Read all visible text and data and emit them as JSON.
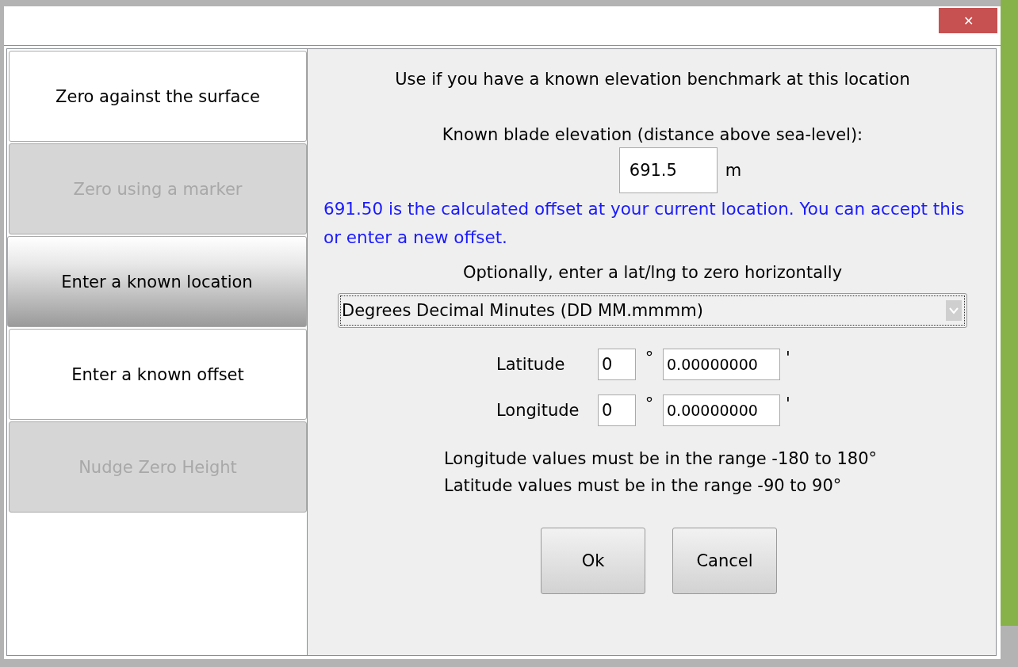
{
  "window": {
    "close": "✕"
  },
  "sidebar": {
    "items": [
      {
        "label": "Zero against the surface",
        "selected": false,
        "disabled": false
      },
      {
        "label": "Zero using a marker",
        "selected": false,
        "disabled": true
      },
      {
        "label": "Enter a known location",
        "selected": true,
        "disabled": false
      },
      {
        "label": "Enter a known offset",
        "selected": false,
        "disabled": false
      },
      {
        "label": "Nudge Zero Height",
        "selected": false,
        "disabled": true
      }
    ]
  },
  "panel": {
    "intro": "Use if you have a known elevation benchmark at this location",
    "elevation_label": "Known blade elevation (distance above sea-level):",
    "elevation_value": "691.5",
    "elevation_unit": "m",
    "notice": "691.50 is the calculated offset at your current location. You can accept this or enter a new offset.",
    "optional_label": "Optionally, enter a lat/lng to zero horizontally",
    "format_select": {
      "value": "Degrees Decimal Minutes (DD MM.mmmm)"
    },
    "coordinates": [
      {
        "label": "Latitude",
        "degrees": "0",
        "degree_sign": "°",
        "minutes": "0.00000000",
        "minute_sign": "'"
      },
      {
        "label": "Longitude",
        "degrees": "0",
        "degree_sign": "°",
        "minutes": "0.00000000",
        "minute_sign": "'"
      }
    ],
    "hints": [
      "Longitude values must be in the range -180 to 180°",
      "Latitude values must be in the range -90 to 90°"
    ],
    "buttons": [
      "Ok",
      "Cancel"
    ]
  }
}
